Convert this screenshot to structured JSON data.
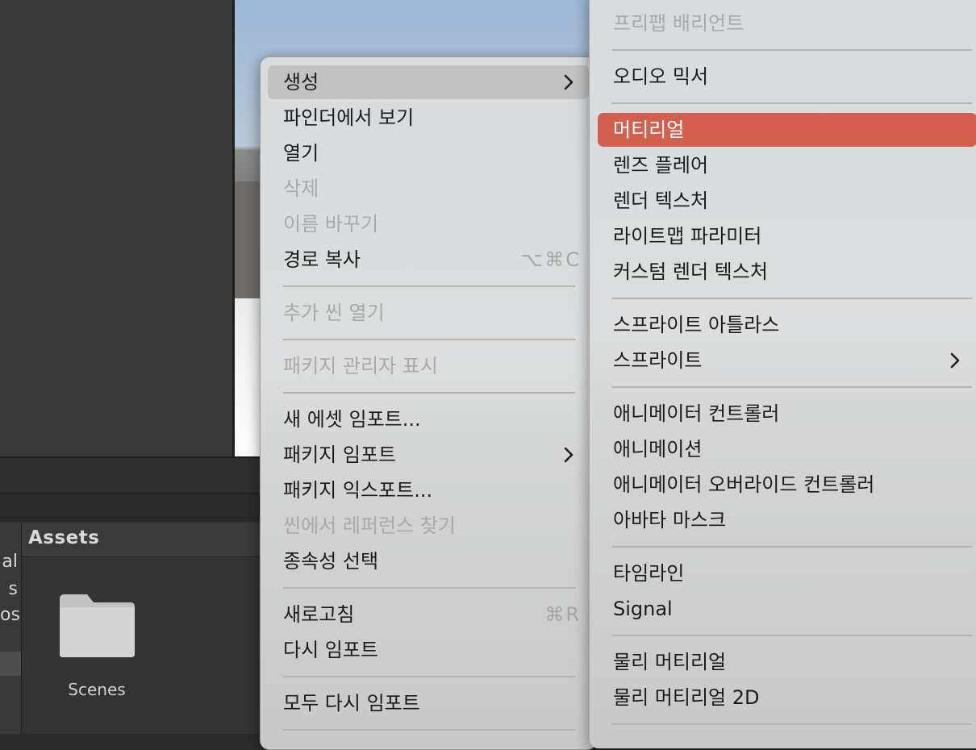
{
  "assets_panel": {
    "title": "Assets",
    "folder_tree_partial": [
      "al",
      "s",
      "os"
    ],
    "folder_name": "Scenes"
  },
  "context_menu": {
    "create": "생성",
    "reveal_in_finder": "파인더에서 보기",
    "open": "열기",
    "delete": "삭제",
    "rename": "이름 바꾸기",
    "copy_path": "경로 복사",
    "copy_path_shortcut": "⌥⌘C",
    "open_scene_additive": "추가 씬 열기",
    "show_package_manager": "패키지 관리자 표시",
    "import_new_asset": "새 에셋 임포트...",
    "import_package": "패키지 임포트",
    "export_package": "패키지 익스포트...",
    "find_references": "씬에서 레퍼런스 찾기",
    "select_dependencies": "종속성 선택",
    "refresh": "새로고침",
    "refresh_shortcut": "⌘R",
    "reimport": "다시 임포트",
    "reimport_all": "모두 다시 임포트"
  },
  "submenu": {
    "prefab_variant": "프리팹 배리언트",
    "audio_mixer": "오디오 믹서",
    "material": "머티리얼",
    "lens_flare": "렌즈 플레어",
    "render_texture": "렌더 텍스처",
    "lightmap_parameters": "라이트맵 파라미터",
    "custom_render_texture": "커스텀 렌더 텍스처",
    "sprite_atlas": "스프라이트 아틀라스",
    "sprites": "스프라이트",
    "animator_controller": "애니메이터 컨트롤러",
    "animation": "애니메이션",
    "animator_override_controller": "애니메이터 오버라이드 컨트롤러",
    "avatar_mask": "아바타 마스크",
    "timeline": "타임라인",
    "signal": "Signal",
    "physic_material": "물리 머티리얼",
    "physic_material_2d": "물리 머티리얼 2D"
  },
  "colors": {
    "selection_accent": "#d35f4e",
    "hover": "#c2c2c2",
    "disabled_text": "#a9a9a9"
  },
  "icons": [
    "chevron-right-icon",
    "folder-icon"
  ]
}
